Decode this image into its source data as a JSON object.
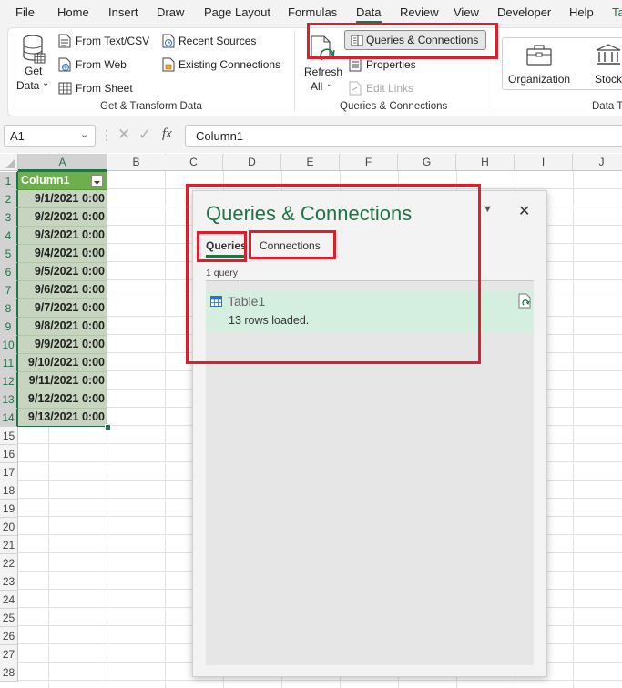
{
  "menu": {
    "items": [
      "File",
      "Home",
      "Insert",
      "Draw",
      "Page Layout",
      "Formulas",
      "Data",
      "Review",
      "View",
      "Developer",
      "Help",
      "Ta"
    ],
    "active": "Data"
  },
  "ribbon": {
    "get_data_label": "Get",
    "get_data_label2": "Data",
    "from_text_csv": "From Text/CSV",
    "from_web": "From Web",
    "from_sheet": "From Sheet",
    "recent_sources": "Recent Sources",
    "existing_connections": "Existing Connections",
    "group_get_transform": "Get & Transform Data",
    "refresh_label": "Refresh",
    "refresh_label2": "All",
    "queries_connections_btn": "Queries & Connections",
    "properties": "Properties",
    "edit_links": "Edit Links",
    "group_queries_connections": "Queries & Connections",
    "organization": "Organization",
    "stocks": "Stock",
    "group_data_types": "Data Ty"
  },
  "formula_bar": {
    "name_box": "A1",
    "fx": "fx",
    "value": "Column1"
  },
  "columns": [
    "A",
    "B",
    "C",
    "D",
    "E",
    "F",
    "G",
    "H",
    "I",
    "J"
  ],
  "rows": [
    "1",
    "2",
    "3",
    "4",
    "5",
    "6",
    "7",
    "8",
    "9",
    "10",
    "11",
    "12",
    "13",
    "14",
    "15",
    "16",
    "17",
    "18",
    "19",
    "20",
    "21",
    "22",
    "23",
    "24",
    "25",
    "26",
    "27",
    "28"
  ],
  "table": {
    "header": "Column1",
    "values": [
      "9/1/2021 0:00",
      "9/2/2021 0:00",
      "9/3/2021 0:00",
      "9/4/2021 0:00",
      "9/5/2021 0:00",
      "9/6/2021 0:00",
      "9/7/2021 0:00",
      "9/8/2021 0:00",
      "9/9/2021 0:00",
      "9/10/2021 0:00",
      "9/11/2021 0:00",
      "9/12/2021 0:00",
      "9/13/2021 0:00"
    ]
  },
  "pane": {
    "title": "Queries & Connections",
    "tab_queries": "Queries",
    "tab_connections": "Connections",
    "query_count": "1 query",
    "query_name": "Table1",
    "query_status": "13 rows loaded."
  },
  "colors": {
    "accent": "#217346",
    "highlight": "#e01e2b",
    "table_header": "#6fae4c",
    "table_fill": "#c6d4c0",
    "query_row": "#d4efe0"
  }
}
